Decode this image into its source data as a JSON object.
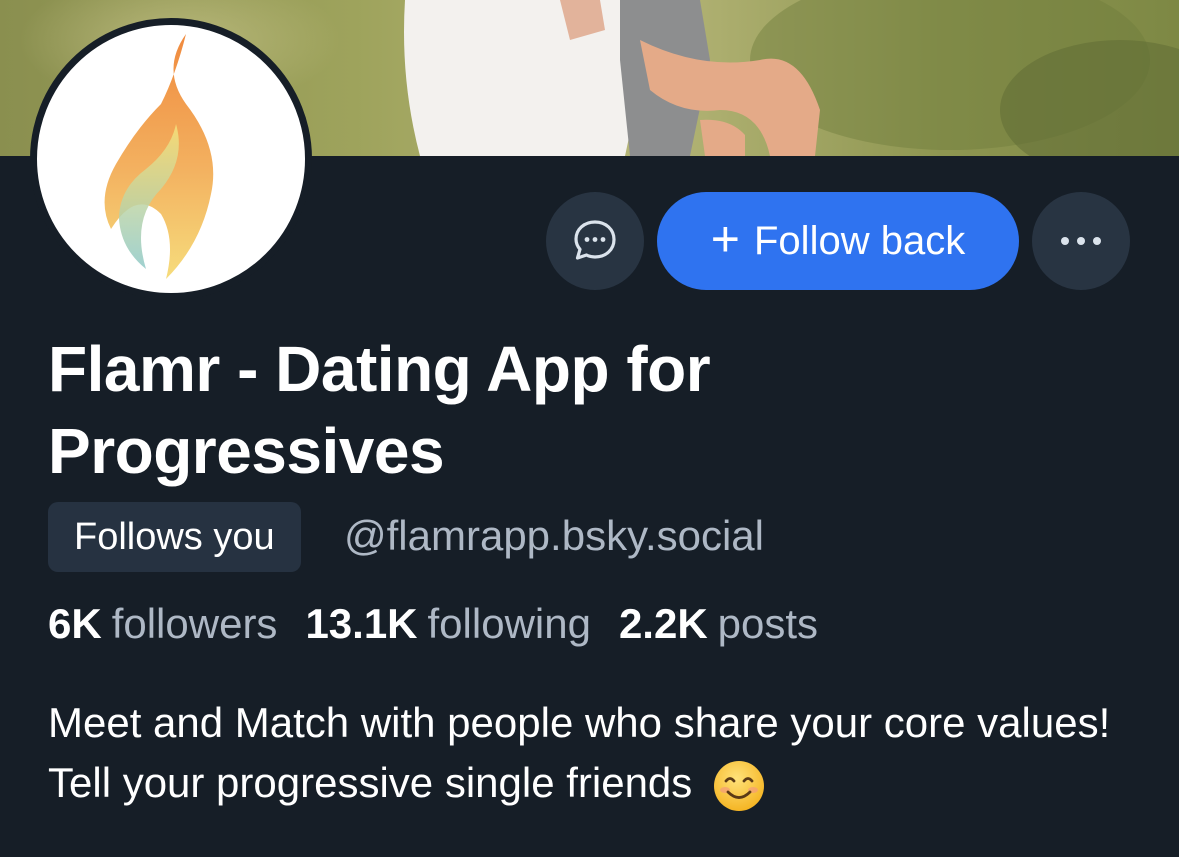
{
  "profile": {
    "display_name": "Flamr - Dating App for Progressives",
    "follows_you": "Follows you",
    "handle": "@flamrapp.bsky.social",
    "bio": "Meet and Match with people who share your core values! Tell your progressive single friends"
  },
  "actions": {
    "follow_back_label": "Follow back",
    "follow_back_icon": "plus-icon",
    "message_icon": "chat-bubble-icon",
    "more_icon": "ellipsis-icon"
  },
  "stats": {
    "followers_count": "6K",
    "followers_label": "followers",
    "following_count": "13.1K",
    "following_label": "following",
    "posts_count": "2.2K",
    "posts_label": "posts"
  },
  "colors": {
    "background": "#161e27",
    "accent": "#2f73f0",
    "muted_text": "#aeb8c5",
    "button_bg": "#283442"
  }
}
